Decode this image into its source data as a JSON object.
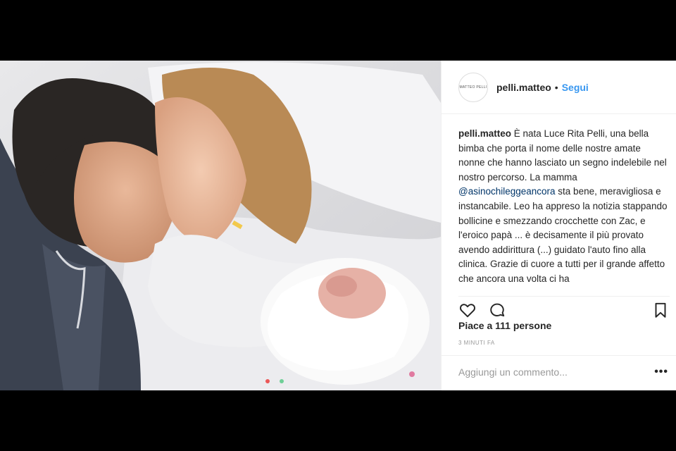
{
  "post": {
    "username": "pelli.matteo",
    "separator": "•",
    "follow_label": "Segui",
    "avatar_text": "MATTEO PELLI",
    "caption": {
      "user": "pelli.matteo",
      "text_before": " È nata Luce Rita Pelli, una bella bimba che porta il nome delle nostre amate nonne che hanno lasciato un segno indelebile nel nostro percorso. La mamma ",
      "mention": "@asinochileggeancora",
      "text_after": " sta bene, meravigliosa e instancabile. Leo ha appreso la notizia stappando bollicine e smezzando crocchette con Zac, e l'eroico papà ... è decisamente il più provato avendo addirittura (...) guidato l'auto fino alla clinica. Grazie di cuore a tutti per il grande affetto che ancora una volta ci ha"
    },
    "likes": "Piace a 111 persone",
    "timestamp": "3 MINUTI FA",
    "comment_placeholder": "Aggiungi un commento...",
    "more_icon": "•••"
  },
  "icons": {
    "like": "heart-icon",
    "comment": "comment-icon",
    "save": "bookmark-icon",
    "more": "more-options-icon"
  },
  "colors": {
    "link": "#3897f0",
    "text": "#262626",
    "muted": "#999999",
    "mention": "#003569"
  }
}
